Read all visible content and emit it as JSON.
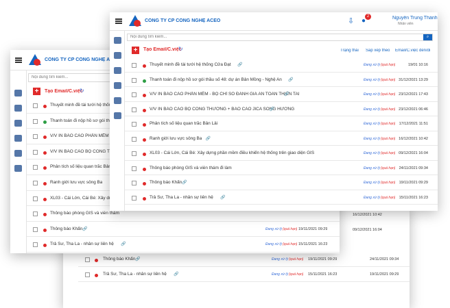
{
  "company": "CÔNG TY CP CÔNG NGHỆ ACEO",
  "logo_text": "ACEO",
  "user": {
    "name": "Nguyễn Trung Thành",
    "role": "Nhân viên"
  },
  "notification_count": "2",
  "search_placeholder": "Nội dung tìm kiếm...",
  "create_button": "Tạo Email/C.việc",
  "filters": {
    "status": "Trạng thái",
    "sort": "Sắp xếp theo",
    "email_to": "Email/C.việc đến/đi"
  },
  "status_label": "Đang xử lý",
  "status_suffix": "(quá hạn)",
  "front_rows": [
    {
      "title": "Thuyết minh đề tài tưới hệ thống Cửa Đạt",
      "date": "19/01 10:16",
      "clip": true,
      "dot": "red"
    },
    {
      "title": "Thanh toán đi nộp hồ sơ gói thầu số 48: dự án Bản Mồng - Nghệ An",
      "date": "31/12/2021 13:29",
      "clip": true,
      "dot": "green"
    },
    {
      "title": "V/V IN BÁO CÁO PHẦN MỀM - BỘ CHỈ SỐ ĐÁNH GIÁ AN TOÀN THIÊN TAI",
      "date": "23/12/2021 17:43",
      "clip": true,
      "dot": "red"
    },
    {
      "title": "V/V IN BÁO CÁO BỘ CÔNG THƯƠNG + BÁO CÁO JICA SÔNG HƯƠNG",
      "date": "23/12/2021 06:46",
      "clip": true,
      "dot": "red"
    },
    {
      "title": "Phân tích số liệu quan trắc Bản Lải",
      "date": "17/12/2021 11:51",
      "clip": false,
      "dot": "red"
    },
    {
      "title": "Ranh giới lưu vực sông Ba",
      "date": "16/12/2021 10:42",
      "clip": true,
      "dot": "red"
    },
    {
      "title": "XL03 - Cái Lớn, Cái Bé: Xây dựng phần mềm điều khiển hệ thống trên giao diện GIS",
      "date": "09/12/2021 16:04",
      "clip": false,
      "dot": "red"
    },
    {
      "title": "Thông báo phòng GIS và viễn thám đi làm",
      "date": "24/11/2021 09:34",
      "clip": false,
      "dot": "red"
    },
    {
      "title": "Thông báo Khẩn",
      "date": "19/11/2021 09:29",
      "clip": true,
      "dot": "red"
    },
    {
      "title": "Trả Sư, Tha La - nhân sự liên hệ",
      "date": "15/11/2021 16:23",
      "clip": true,
      "dot": "red"
    }
  ],
  "left_rows": [
    {
      "title": "Thuyết minh đề tài tưới hệ thống Cửa",
      "dot": "red"
    },
    {
      "title": "Thanh toán đi nộp hồ sơ gói thầu số",
      "dot": "green"
    },
    {
      "title": "V/V IN BÁO CÁO PHẦN MỀM - BỘ",
      "dot": "red"
    },
    {
      "title": "V/V IN BÁO CÁO BỘ CÔNG THƯƠ",
      "dot": "red"
    },
    {
      "title": "Phân tích số liệu quan trắc Bản Lải",
      "dot": "red"
    },
    {
      "title": "Ranh giới lưu vực sông Ba",
      "dot": "red"
    },
    {
      "title": "XL03 - Cái Lớn, Cái Bé: Xây dựng p",
      "dot": "red"
    },
    {
      "title": "Thông báo phòng GIS và viễn thám",
      "dot": "red"
    },
    {
      "title": "Thông báo Khẩn",
      "dot": "red",
      "date": "19/11/2021 09:29",
      "right_date": "16/12/2021 10:42"
    },
    {
      "title": "Trả Sư, Tha La - nhân sự liên hệ",
      "dot": "red",
      "date": "15/11/2021 16:23",
      "right_date": "09/12/2021 16:04"
    }
  ],
  "back_rows": [
    {
      "title": "Thông báo Khẩn",
      "date": "19/11/2021 09:29",
      "right_date": "24/11/2021 09:34"
    },
    {
      "title": "Trả Sư, Tha La - nhân sự liên hệ",
      "date": "15/11/2021 16:23",
      "right_date": "19/11/2021 09:29"
    }
  ],
  "colors": {
    "accent": "#1565c0",
    "red": "#e02a2a",
    "green": "#2e9e45",
    "status": "#3a6fd8"
  }
}
